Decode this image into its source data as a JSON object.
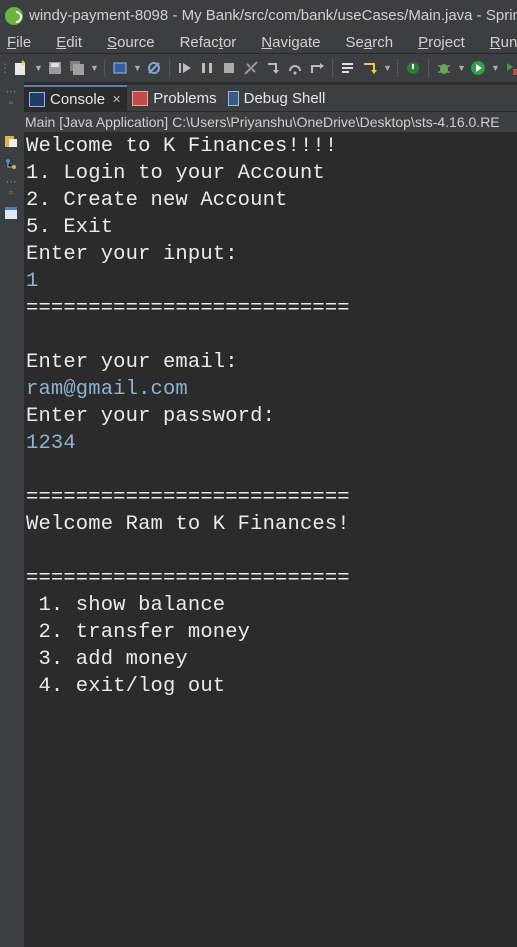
{
  "window": {
    "title": "windy-payment-8098 - My Bank/src/com/bank/useCases/Main.java - Sprin"
  },
  "menubar": {
    "items": [
      {
        "mnemonic": "F",
        "rest": "ile"
      },
      {
        "mnemonic": "E",
        "rest": "dit"
      },
      {
        "mnemonic": "S",
        "rest": "ource"
      },
      {
        "mnemonic": "",
        "rest": "Refac",
        "mnemonic2": "t",
        "rest2": "or"
      },
      {
        "mnemonic": "N",
        "rest": "avigate"
      },
      {
        "mnemonic": "",
        "rest": "Se",
        "mnemonic2": "a",
        "rest2": "rch"
      },
      {
        "mnemonic": "P",
        "rest": "roject"
      },
      {
        "mnemonic": "R",
        "rest": "un"
      }
    ]
  },
  "tabs": [
    {
      "label": "Console",
      "icon": "console-icon",
      "active": true,
      "closable": true
    },
    {
      "label": "Problems",
      "icon": "problems-icon",
      "active": false
    },
    {
      "label": "Debug Shell",
      "icon": "debug-shell-icon",
      "active": false
    }
  ],
  "launch": {
    "description": "Main [Java Application] C:\\Users\\Priyanshu\\OneDrive\\Desktop\\sts-4.16.0.RE"
  },
  "console": {
    "lines": [
      {
        "text": "Welcome to K Finances!!!!",
        "kind": "output"
      },
      {
        "text": "1. Login to your Account",
        "kind": "output"
      },
      {
        "text": "2. Create new Account",
        "kind": "output"
      },
      {
        "text": "5. Exit",
        "kind": "output"
      },
      {
        "text": "Enter your input:",
        "kind": "output"
      },
      {
        "text": "1",
        "kind": "input"
      },
      {
        "text": "==========================",
        "kind": "output"
      },
      {
        "text": "",
        "kind": "output"
      },
      {
        "text": "Enter your email:",
        "kind": "output"
      },
      {
        "text": "ram@gmail.com",
        "kind": "input"
      },
      {
        "text": "Enter your password:",
        "kind": "output"
      },
      {
        "text": "1234",
        "kind": "input"
      },
      {
        "text": "",
        "kind": "output"
      },
      {
        "text": "==========================",
        "kind": "output"
      },
      {
        "text": "Welcome Ram to K Finances!",
        "kind": "output"
      },
      {
        "text": "",
        "kind": "output"
      },
      {
        "text": "==========================",
        "kind": "output"
      },
      {
        "text": " 1. show balance",
        "kind": "output"
      },
      {
        "text": " 2. transfer money",
        "kind": "output"
      },
      {
        "text": " 3. add money",
        "kind": "output"
      },
      {
        "text": " 4. exit/log out",
        "kind": "output"
      }
    ]
  },
  "colors": {
    "output_text": "#ebebeb",
    "input_text": "#8fb1d3",
    "console_bg": "#2b2b2b",
    "chrome_bg": "#3c3f41",
    "active_tab_border": "#5a7fb5"
  }
}
